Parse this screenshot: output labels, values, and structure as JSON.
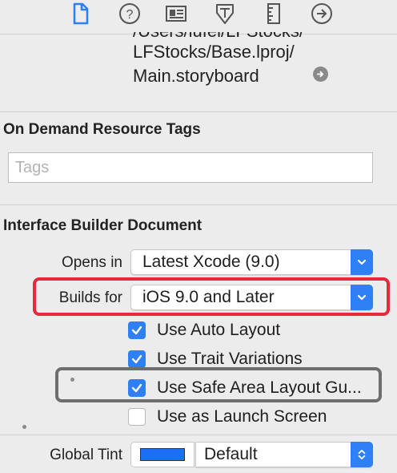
{
  "toolbar": {
    "tabs": [
      {
        "name": "file-inspector-icon",
        "active": true
      },
      {
        "name": "quick-help-icon",
        "active": false
      },
      {
        "name": "identity-inspector-icon",
        "active": false
      },
      {
        "name": "attributes-inspector-icon",
        "active": false
      },
      {
        "name": "size-inspector-icon",
        "active": false
      },
      {
        "name": "connections-inspector-icon",
        "active": false
      }
    ]
  },
  "location": {
    "path_line_1": "LFStocks/Base.lproj/",
    "path_line_0": "/Users/lufei/LFStocks/",
    "path_line_2": "Main.storyboard"
  },
  "on_demand": {
    "title": "On Demand Resource Tags",
    "tags_placeholder": "Tags"
  },
  "ib_document": {
    "title": "Interface Builder Document",
    "opens_in_label": "Opens in",
    "opens_in_value": "Latest Xcode (9.0)",
    "builds_for_label": "Builds for",
    "builds_for_value": "iOS 9.0 and Later",
    "checkboxes": [
      {
        "label": "Use Auto Layout",
        "checked": true
      },
      {
        "label": "Use Trait Variations",
        "checked": true
      },
      {
        "label": "Use Safe Area Layout Gu...",
        "checked": true
      },
      {
        "label": "Use as Launch Screen",
        "checked": false
      }
    ],
    "global_tint_label": "Global Tint",
    "global_tint_value": "Default",
    "global_tint_color": "#1a6ff5"
  },
  "colors": {
    "accent": "#2f7ff6",
    "highlight_red": "#e7293b",
    "highlight_grey": "#6e6e6e"
  }
}
